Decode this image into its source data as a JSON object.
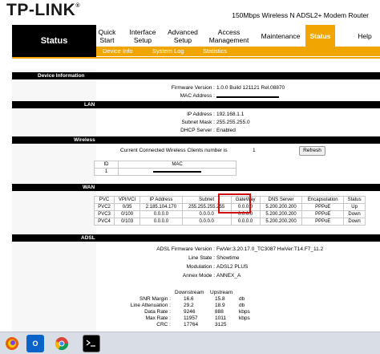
{
  "brand": {
    "logo": "TP-LINK",
    "trademark": "®",
    "model": "150Mbps Wireless N ADSL2+ Modem Router"
  },
  "nav": {
    "status_label": "Status",
    "items": [
      "Quick Start",
      "Interface Setup",
      "Advanced Setup",
      "Access Management",
      "Maintenance",
      "Status",
      "Help"
    ],
    "subitems": [
      "Device Info",
      "System Log",
      "Statistics"
    ]
  },
  "device_info": {
    "section": "Device Information",
    "firmware_label": "Firmware Version :",
    "firmware_value": "1.0.0 Build 121121 Rel.08870",
    "mac_label": "MAC Address :"
  },
  "lan": {
    "section": "LAN",
    "ip_label": "IP Address :",
    "ip_value": "192.168.1.1",
    "mask_label": "Subnet Mask :",
    "mask_value": "255.255.255.0",
    "dhcp_label": "DHCP Server :",
    "dhcp_value": "Enabled"
  },
  "wireless": {
    "section": "Wireless",
    "clients_label": "Current Connected Wireless Clients number is",
    "clients_value": "1",
    "refresh_label": "Refresh",
    "table_headers": [
      "ID",
      "MAC"
    ],
    "table_rows": [
      [
        "1",
        ""
      ]
    ]
  },
  "wan": {
    "section": "WAN",
    "headers": [
      "PVC",
      "VPI/VCI",
      "IP Address",
      "Subnet",
      "GateWay",
      "DNS Server",
      "Encapsulation",
      "Status"
    ],
    "rows": [
      [
        "PVC2",
        "0/35",
        "2.185.104.170",
        "255.255.255.255",
        "0.0.0.0",
        "5.200.200.200",
        "PPPoE",
        "Up"
      ],
      [
        "PVC3",
        "0/100",
        "0.0.0.0",
        "0.0.0.0",
        "0.0.0.0",
        "5.200.200.200",
        "PPPoE",
        "Down"
      ],
      [
        "PVC4",
        "0/103",
        "0.0.0.0",
        "0.0.0.0",
        "0.0.0.0",
        "5.200.200.200",
        "PPPoE",
        "Down"
      ]
    ]
  },
  "adsl": {
    "section": "ADSL",
    "fw_label": "ADSL Firmware Version :",
    "fw_value": "FwVer:3.20.17.0_TC3087 HwVer:T14.F7_11.2",
    "line_label": "Line State :",
    "line_value": "Showtime",
    "mod_label": "Modulation :",
    "mod_value": "ADSL2 PLUS",
    "annex_label": "Annex Mode :",
    "annex_value": "ANNEX_A",
    "col_down": "Downstream",
    "col_up": "Upstream",
    "stats": [
      {
        "label": "SNR Margin :",
        "down": "16.6",
        "up": "15.8",
        "unit": "db"
      },
      {
        "label": "Line Attenuation :",
        "down": "29.2",
        "up": "18.9",
        "unit": "db"
      },
      {
        "label": "Data Rate :",
        "down": "9246",
        "up": "888",
        "unit": "kbps"
      },
      {
        "label": "Max Rate :",
        "down": "11957",
        "up": "1011",
        "unit": "kbps"
      },
      {
        "label": "CRC :",
        "down": "17764",
        "up": "3125",
        "unit": ""
      }
    ]
  },
  "taskbar": {
    "icons": [
      "firefox-icon",
      "outlook-icon",
      "chrome-icon",
      "terminal-icon"
    ],
    "outlook_letter": "O"
  }
}
